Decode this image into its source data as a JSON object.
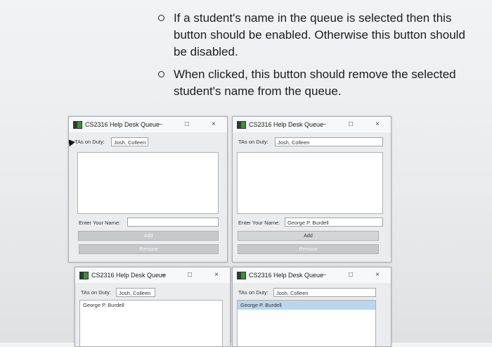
{
  "instructions": [
    "If a student's name in the queue is selected then this button should be enabled. Otherwise this button should be disabled.",
    "When clicked, this button should remove the selected student's name from the queue."
  ],
  "windows": [
    {
      "title": "CS2316 Help Desk Queue",
      "controls": {
        "minimize": "–",
        "maximize": "□",
        "close": "×"
      },
      "tas_label": "TAs on Duty:",
      "tas_value": "Josh, Colleen",
      "name_label": "Enter Your Name:",
      "name_value": "",
      "add_label": "Add",
      "remove_label": "Remove",
      "queue": []
    },
    {
      "title": "CS2316 Help Desk Queue",
      "controls": {
        "minimize": "–",
        "maximize": "□",
        "close": "×"
      },
      "tas_label": "TAs on Duty:",
      "tas_value": "Josh, Colleen",
      "name_label": "Enter Your Name:",
      "name_value": "George P. Burdell",
      "add_label": "Add",
      "remove_label": "Remove",
      "queue": []
    },
    {
      "title": "CS2316 Help Desk Queue",
      "controls": {
        "minimize": "–",
        "maximize": "□",
        "close": "×"
      },
      "tas_label": "TAs on Duty:",
      "tas_value": "Josh, Colleen",
      "queue": [
        "George P. Burdell"
      ]
    },
    {
      "title": "CS2316 Help Desk Queue",
      "controls": {
        "minimize": "–",
        "maximize": "□",
        "close": "×"
      },
      "tas_label": "TAs on Duty:",
      "tas_value": "Josh, Colleen",
      "queue": [
        "George P. Burdell"
      ],
      "queue_selected": "George P. Burdell"
    }
  ],
  "icons": [
    "bullet-circle-icon",
    "app-icon",
    "minimize-icon",
    "maximize-icon",
    "close-icon",
    "mouse-pointer-icon"
  ]
}
